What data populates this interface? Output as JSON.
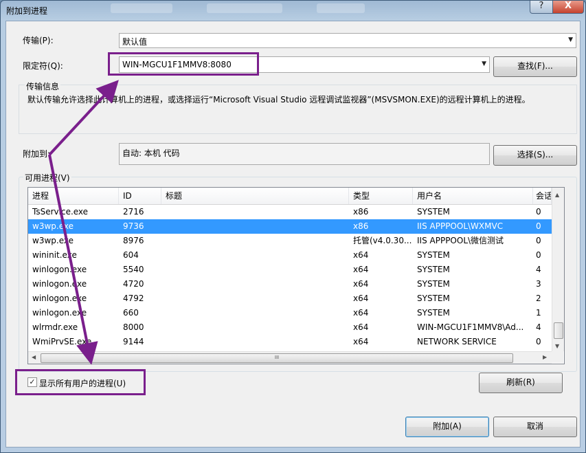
{
  "window": {
    "title": "附加到进程",
    "help_label": "?",
    "close_label": "X"
  },
  "transport": {
    "label": "传输(P):",
    "value": "默认值"
  },
  "qualifier": {
    "label": "限定符(Q):",
    "value": "WIN-MGCU1F1MMV8:8080",
    "find_button": "查找(F)..."
  },
  "transport_info": {
    "title": "传输信息",
    "text": "默认传输允许选择此计算机上的进程，或选择运行“Microsoft Visual Studio 远程调试监视器”(MSVSMON.EXE)的远程计算机上的进程。"
  },
  "attach_to": {
    "label": "附加到:",
    "value": "自动: 本机 代码",
    "select_button": "选择(S)..."
  },
  "processes": {
    "title": "可用进程(V)",
    "columns": [
      "进程",
      "ID",
      "标题",
      "类型",
      "用户名",
      "会话"
    ],
    "rows": [
      {
        "process": "TsService.exe",
        "id": "2716",
        "title": "",
        "type": "x86",
        "user": "SYSTEM",
        "session": "0",
        "selected": false
      },
      {
        "process": "w3wp.exe",
        "id": "9736",
        "title": "",
        "type": "x86",
        "user": "IIS APPPOOL\\WXMVC",
        "session": "0",
        "selected": true
      },
      {
        "process": "w3wp.exe",
        "id": "8976",
        "title": "",
        "type": "托管(v4.0.30...",
        "user": "IIS APPPOOL\\微信测试",
        "session": "0",
        "selected": false
      },
      {
        "process": "wininit.exe",
        "id": "604",
        "title": "",
        "type": "x64",
        "user": "SYSTEM",
        "session": "0",
        "selected": false
      },
      {
        "process": "winlogon.exe",
        "id": "5540",
        "title": "",
        "type": "x64",
        "user": "SYSTEM",
        "session": "4",
        "selected": false
      },
      {
        "process": "winlogon.exe",
        "id": "4720",
        "title": "",
        "type": "x64",
        "user": "SYSTEM",
        "session": "3",
        "selected": false
      },
      {
        "process": "winlogon.exe",
        "id": "4792",
        "title": "",
        "type": "x64",
        "user": "SYSTEM",
        "session": "2",
        "selected": false
      },
      {
        "process": "winlogon.exe",
        "id": "660",
        "title": "",
        "type": "x64",
        "user": "SYSTEM",
        "session": "1",
        "selected": false
      },
      {
        "process": "wlrmdr.exe",
        "id": "8000",
        "title": "",
        "type": "x64",
        "user": "WIN-MGCU1F1MMV8\\Ad...",
        "session": "4",
        "selected": false
      },
      {
        "process": "WmiPrvSE.exe",
        "id": "9144",
        "title": "",
        "type": "x64",
        "user": "NETWORK SERVICE",
        "session": "0",
        "selected": false
      }
    ],
    "scroll_grip": "III"
  },
  "show_all_users": {
    "label": "显示所有用户的进程(U)",
    "checked": true,
    "check_glyph": "✓"
  },
  "buttons": {
    "refresh": "刷新(R)",
    "attach": "附加(A)",
    "cancel": "取消"
  },
  "colors": {
    "selection": "#3399ff",
    "annotation": "#7a1f8c"
  }
}
